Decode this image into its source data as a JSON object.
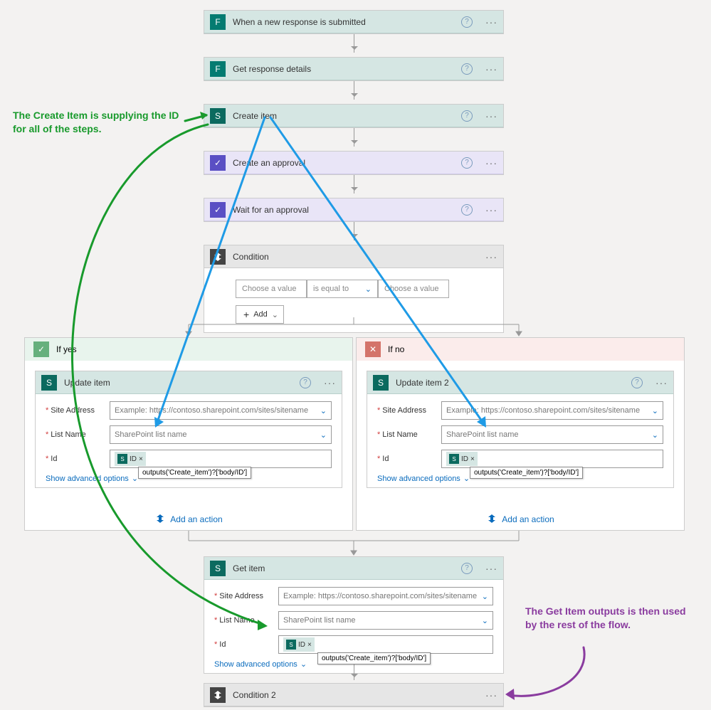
{
  "annotations": {
    "left_top": "The Create Item is supplying the ID for all of the steps.",
    "right_bottom": "The Get Item outputs is then used by the rest of the flow."
  },
  "steps": {
    "trigger": {
      "title": "When a new response is submitted"
    },
    "get_resp": {
      "title": "Get response details"
    },
    "create_item": {
      "title": "Create item"
    },
    "create_appr": {
      "title": "Create an approval"
    },
    "wait_appr": {
      "title": "Wait for an approval"
    },
    "condition": {
      "title": "Condition"
    },
    "condition2": {
      "title": "Condition 2"
    },
    "get_item": {
      "title": "Get item"
    }
  },
  "condition": {
    "value1_ph": "Choose a value",
    "op": "is equal to",
    "value2_ph": "Choose a value",
    "add": "Add"
  },
  "branches": {
    "yes": "If yes",
    "no": "If no"
  },
  "update": {
    "left_title": "Update item",
    "right_title": "Update item 2",
    "site_label": "Site Address",
    "site_ph": "Example: https://contoso.sharepoint.com/sites/sitename",
    "list_label": "List Name",
    "list_ph": "SharePoint list name",
    "id_label": "Id",
    "token": "ID",
    "tooltip": "outputs('Create_item')?['body/ID']",
    "adv": "Show advanced options",
    "addaction": "Add an action"
  },
  "getitem": {
    "site_label": "Site Address",
    "site_ph": "Example: https://contoso.sharepoint.com/sites/sitename",
    "list_label": "List Name",
    "list_ph": "SharePoint list name",
    "id_label": "Id",
    "token": "ID",
    "tooltip": "outputs('Create_item')?['body/ID']",
    "adv": "Show advanced options"
  }
}
